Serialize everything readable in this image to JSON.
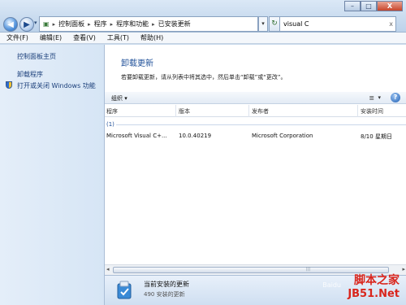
{
  "address": {
    "crumbs": [
      "控制面板",
      "程序",
      "程序和功能",
      "已安装更新"
    ],
    "refresh_glyph": "↻",
    "search_value": "visual C",
    "search_clear": "x"
  },
  "window_controls": {
    "min": "–",
    "max": "□",
    "close": "X"
  },
  "menu": [
    "文件(F)",
    "编辑(E)",
    "查看(V)",
    "工具(T)",
    "帮助(H)"
  ],
  "left_pane": {
    "home": "控制面板主页",
    "uninstall": "卸载程序",
    "features": "打开或关闭 Windows 功能"
  },
  "main": {
    "title": "卸载更新",
    "description": "若要卸载更新，请从列表中将其选中，然后单击“卸载”或“更改”。"
  },
  "toolbar": {
    "organize": "组织 ▾",
    "view_icon": "≣",
    "view_dropdown": "▾",
    "help": "?"
  },
  "columns": [
    "程序",
    "版本",
    "发布者",
    "安装时间"
  ],
  "group_label": "(1)",
  "rows": [
    {
      "program": "Microsoft Visual C+...",
      "version": "10.0.40219",
      "publisher": "Microsoft Corporation",
      "installed": "8/10 星期日"
    }
  ],
  "details": {
    "title": "当前安装的更新",
    "count": "490 安装的更新"
  },
  "watermark": {
    "line1": "脚本之家",
    "line2": "JB51.Net",
    "faint": "Baidu"
  },
  "colors": {
    "link": "#1b3f7a",
    "title": "#1e4f98",
    "watermark": "#d9251c"
  }
}
